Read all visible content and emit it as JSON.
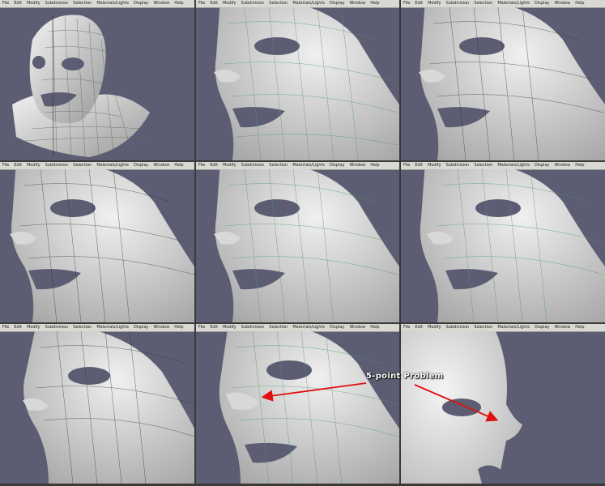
{
  "menu_items": [
    "File",
    "Edit",
    "Modify",
    "Subdivision",
    "Selection",
    "Materials/Lights",
    "Display",
    "Window",
    "Help"
  ],
  "annotation": {
    "label": "5-point Problem",
    "color": "#e01010"
  },
  "colors": {
    "viewport_bg": "#5c5d73",
    "mesh_surface": "#e6e6e6",
    "wire_green": "#4a9a6a",
    "wire_dark": "#222222"
  }
}
